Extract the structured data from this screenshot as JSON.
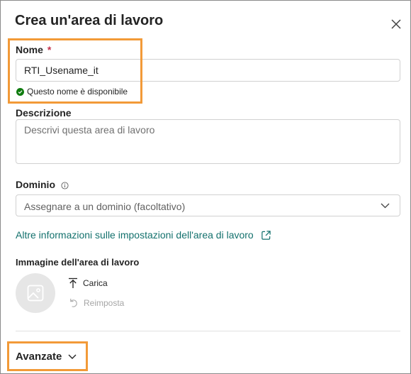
{
  "dialog": {
    "title": "Crea un'area di lavoro"
  },
  "name_field": {
    "label": "Nome",
    "required_mark": "*",
    "value": "RTI_Usename_it",
    "status_text": "Questo nome è disponibile"
  },
  "description_field": {
    "label": "Descrizione",
    "placeholder": "Descrivi questa area di lavoro"
  },
  "domain_field": {
    "label": "Dominio",
    "selected": "Assegnare a un dominio (facoltativo)"
  },
  "settings_link": {
    "text": "Altre informazioni sulle impostazioni dell'area di lavoro"
  },
  "image_section": {
    "label": "Immagine dell'area di lavoro",
    "upload_label": "Carica",
    "reset_label": "Reimposta"
  },
  "advanced": {
    "label": "Avanzate"
  },
  "colors": {
    "highlight": "#f29a38",
    "link": "#13716d",
    "success": "#107c10",
    "required": "#c4314b"
  }
}
